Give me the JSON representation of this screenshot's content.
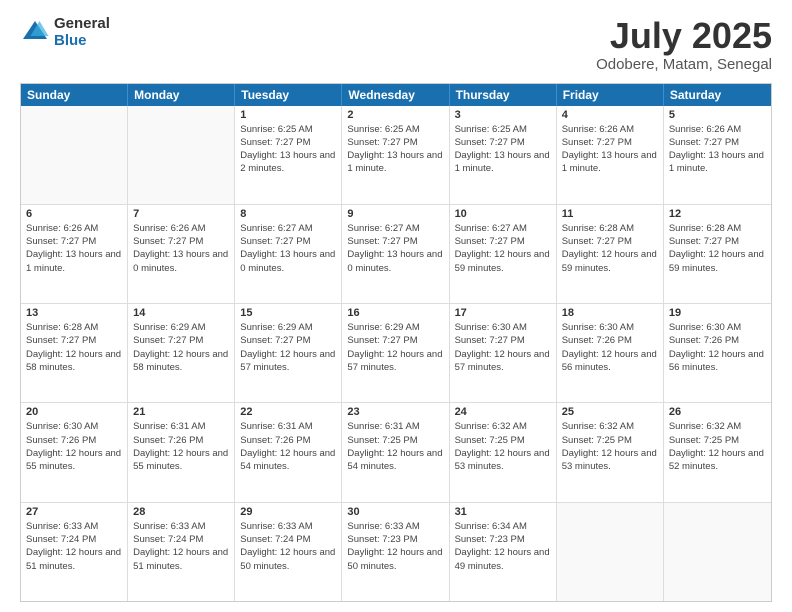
{
  "header": {
    "logo_general": "General",
    "logo_blue": "Blue",
    "title": "July 2025",
    "location": "Odobere, Matam, Senegal"
  },
  "calendar": {
    "days_of_week": [
      "Sunday",
      "Monday",
      "Tuesday",
      "Wednesday",
      "Thursday",
      "Friday",
      "Saturday"
    ],
    "weeks": [
      [
        {
          "day": "",
          "empty": true
        },
        {
          "day": "",
          "empty": true
        },
        {
          "day": "1",
          "info": "Sunrise: 6:25 AM\nSunset: 7:27 PM\nDaylight: 13 hours and 2 minutes."
        },
        {
          "day": "2",
          "info": "Sunrise: 6:25 AM\nSunset: 7:27 PM\nDaylight: 13 hours and 1 minute."
        },
        {
          "day": "3",
          "info": "Sunrise: 6:25 AM\nSunset: 7:27 PM\nDaylight: 13 hours and 1 minute."
        },
        {
          "day": "4",
          "info": "Sunrise: 6:26 AM\nSunset: 7:27 PM\nDaylight: 13 hours and 1 minute."
        },
        {
          "day": "5",
          "info": "Sunrise: 6:26 AM\nSunset: 7:27 PM\nDaylight: 13 hours and 1 minute."
        }
      ],
      [
        {
          "day": "6",
          "info": "Sunrise: 6:26 AM\nSunset: 7:27 PM\nDaylight: 13 hours and 1 minute."
        },
        {
          "day": "7",
          "info": "Sunrise: 6:26 AM\nSunset: 7:27 PM\nDaylight: 13 hours and 0 minutes."
        },
        {
          "day": "8",
          "info": "Sunrise: 6:27 AM\nSunset: 7:27 PM\nDaylight: 13 hours and 0 minutes."
        },
        {
          "day": "9",
          "info": "Sunrise: 6:27 AM\nSunset: 7:27 PM\nDaylight: 13 hours and 0 minutes."
        },
        {
          "day": "10",
          "info": "Sunrise: 6:27 AM\nSunset: 7:27 PM\nDaylight: 12 hours and 59 minutes."
        },
        {
          "day": "11",
          "info": "Sunrise: 6:28 AM\nSunset: 7:27 PM\nDaylight: 12 hours and 59 minutes."
        },
        {
          "day": "12",
          "info": "Sunrise: 6:28 AM\nSunset: 7:27 PM\nDaylight: 12 hours and 59 minutes."
        }
      ],
      [
        {
          "day": "13",
          "info": "Sunrise: 6:28 AM\nSunset: 7:27 PM\nDaylight: 12 hours and 58 minutes."
        },
        {
          "day": "14",
          "info": "Sunrise: 6:29 AM\nSunset: 7:27 PM\nDaylight: 12 hours and 58 minutes."
        },
        {
          "day": "15",
          "info": "Sunrise: 6:29 AM\nSunset: 7:27 PM\nDaylight: 12 hours and 57 minutes."
        },
        {
          "day": "16",
          "info": "Sunrise: 6:29 AM\nSunset: 7:27 PM\nDaylight: 12 hours and 57 minutes."
        },
        {
          "day": "17",
          "info": "Sunrise: 6:30 AM\nSunset: 7:27 PM\nDaylight: 12 hours and 57 minutes."
        },
        {
          "day": "18",
          "info": "Sunrise: 6:30 AM\nSunset: 7:26 PM\nDaylight: 12 hours and 56 minutes."
        },
        {
          "day": "19",
          "info": "Sunrise: 6:30 AM\nSunset: 7:26 PM\nDaylight: 12 hours and 56 minutes."
        }
      ],
      [
        {
          "day": "20",
          "info": "Sunrise: 6:30 AM\nSunset: 7:26 PM\nDaylight: 12 hours and 55 minutes."
        },
        {
          "day": "21",
          "info": "Sunrise: 6:31 AM\nSunset: 7:26 PM\nDaylight: 12 hours and 55 minutes."
        },
        {
          "day": "22",
          "info": "Sunrise: 6:31 AM\nSunset: 7:26 PM\nDaylight: 12 hours and 54 minutes."
        },
        {
          "day": "23",
          "info": "Sunrise: 6:31 AM\nSunset: 7:25 PM\nDaylight: 12 hours and 54 minutes."
        },
        {
          "day": "24",
          "info": "Sunrise: 6:32 AM\nSunset: 7:25 PM\nDaylight: 12 hours and 53 minutes."
        },
        {
          "day": "25",
          "info": "Sunrise: 6:32 AM\nSunset: 7:25 PM\nDaylight: 12 hours and 53 minutes."
        },
        {
          "day": "26",
          "info": "Sunrise: 6:32 AM\nSunset: 7:25 PM\nDaylight: 12 hours and 52 minutes."
        }
      ],
      [
        {
          "day": "27",
          "info": "Sunrise: 6:33 AM\nSunset: 7:24 PM\nDaylight: 12 hours and 51 minutes."
        },
        {
          "day": "28",
          "info": "Sunrise: 6:33 AM\nSunset: 7:24 PM\nDaylight: 12 hours and 51 minutes."
        },
        {
          "day": "29",
          "info": "Sunrise: 6:33 AM\nSunset: 7:24 PM\nDaylight: 12 hours and 50 minutes."
        },
        {
          "day": "30",
          "info": "Sunrise: 6:33 AM\nSunset: 7:23 PM\nDaylight: 12 hours and 50 minutes."
        },
        {
          "day": "31",
          "info": "Sunrise: 6:34 AM\nSunset: 7:23 PM\nDaylight: 12 hours and 49 minutes."
        },
        {
          "day": "",
          "empty": true
        },
        {
          "day": "",
          "empty": true
        }
      ]
    ]
  }
}
